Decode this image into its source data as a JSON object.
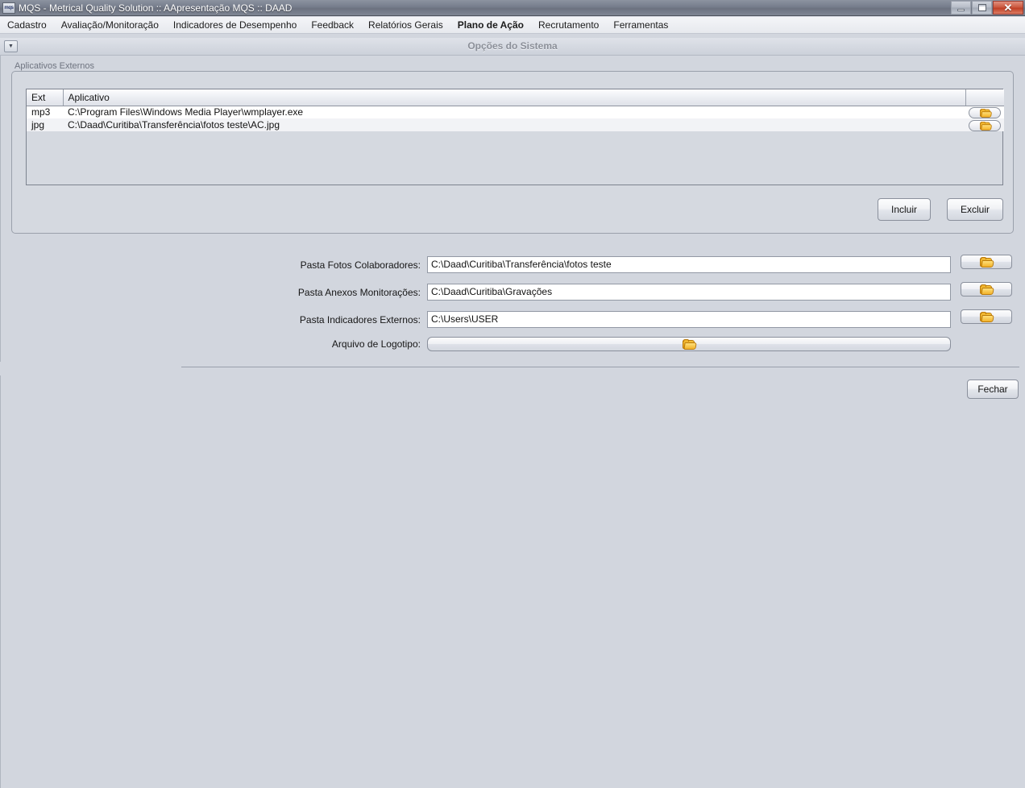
{
  "window": {
    "title": "MQS - Metrical Quality Solution :: AApresentação MQS :: DAAD",
    "icon": "mqs",
    "ghost_text": "",
    "minimize_label": "",
    "maximize_label": "",
    "close_label": "✕"
  },
  "menubar": {
    "items": [
      {
        "label": "Cadastro",
        "active": false
      },
      {
        "label": "Avaliação/Monitoração",
        "active": false
      },
      {
        "label": "Indicadores de Desempenho",
        "active": false
      },
      {
        "label": "Feedback",
        "active": false
      },
      {
        "label": "Relatórios Gerais",
        "active": false
      },
      {
        "label": "Plano de Ação",
        "active": true
      },
      {
        "label": "Recrutamento",
        "active": false
      },
      {
        "label": "Ferramentas",
        "active": false
      }
    ]
  },
  "frame": {
    "title": "Opções do Sistema",
    "menu_button_icon": "▼"
  },
  "group": {
    "label": "Aplicativos Externos",
    "table": {
      "columns": [
        "Ext",
        "Aplicativo",
        ""
      ],
      "rows": [
        {
          "ext": "mp3",
          "aplicativo": "C:\\Program Files\\Windows Media Player\\wmplayer.exe",
          "browse_icon": "folder-icon"
        },
        {
          "ext": "jpg",
          "aplicativo": "C:\\Daad\\Curitiba\\Transferência\\fotos teste\\AC.jpg",
          "browse_icon": "folder-icon"
        }
      ]
    },
    "buttons": {
      "incluir": "Incluir",
      "excluir": "Excluir"
    }
  },
  "form": {
    "fields": [
      {
        "label": "Pasta Fotos Colaboradores:",
        "value": "C:\\Daad\\Curitiba\\Transferência\\fotos teste",
        "placeholder": "",
        "browse_icon": "folder-icon"
      },
      {
        "label": "Pasta Anexos Monitorações:",
        "value": "C:\\Daad\\Curitiba\\Gravações",
        "placeholder": "",
        "browse_icon": "folder-icon"
      },
      {
        "label": "Pasta Indicadores Externos:",
        "value": "C:\\Users\\USER",
        "placeholder": "",
        "browse_icon": "folder-icon"
      }
    ],
    "logo_field": {
      "label": "Arquivo de Logotipo:",
      "value": "",
      "browse_icon": "folder-icon"
    }
  },
  "footer": {
    "fechar": "Fechar"
  },
  "colors": {
    "background": "#d2d6de",
    "titlebar": "#767d8c",
    "close_button": "#bf4026",
    "folder_icon": "#f2b32a",
    "frame_title": "#8b8f98"
  }
}
